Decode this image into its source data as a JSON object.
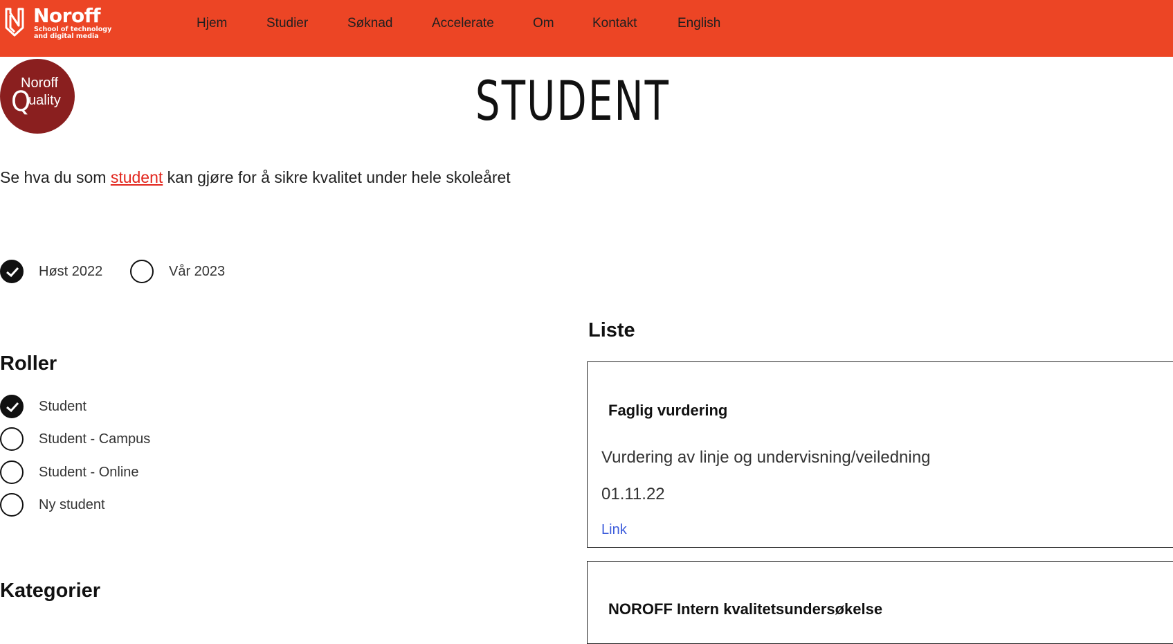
{
  "header": {
    "brand_name": "Noroff",
    "brand_tagline": "School of technology and digital media",
    "nav": [
      {
        "label": "Hjem"
      },
      {
        "label": "Studier"
      },
      {
        "label": "Søknad"
      },
      {
        "label": "Accelerate"
      },
      {
        "label": "Om"
      },
      {
        "label": "Kontakt"
      },
      {
        "label": "English"
      }
    ]
  },
  "badge": {
    "line1": "Noroff",
    "big_letter": "Q",
    "rest": "uality"
  },
  "page": {
    "title": "STUDENT",
    "intro_before": "Se hva du som ",
    "intro_link": "student",
    "intro_after": " kan gjøre for å sikre kvalitet under hele skoleåret"
  },
  "semesters": [
    {
      "label": "Høst 2022",
      "checked": true
    },
    {
      "label": "Vår 2023",
      "checked": false
    }
  ],
  "roles": {
    "heading": "Roller",
    "items": [
      {
        "label": "Student",
        "checked": true
      },
      {
        "label": "Student - Campus",
        "checked": false
      },
      {
        "label": "Student - Online",
        "checked": false
      },
      {
        "label": "Ny student",
        "checked": false
      }
    ]
  },
  "categories": {
    "heading": "Kategorier"
  },
  "list": {
    "heading": "Liste",
    "cards": [
      {
        "title": "Faglig vurdering",
        "description": "Vurdering av linje og undervisning/veiledning",
        "date": "01.11.22",
        "link_label": "Link"
      },
      {
        "title": "NOROFF Intern kvalitetsundersøkelse"
      }
    ]
  },
  "colors": {
    "brand": "#ec4525",
    "badge": "#8a1f1f",
    "link": "#3b5bdb",
    "intro_link": "#e2241b"
  }
}
